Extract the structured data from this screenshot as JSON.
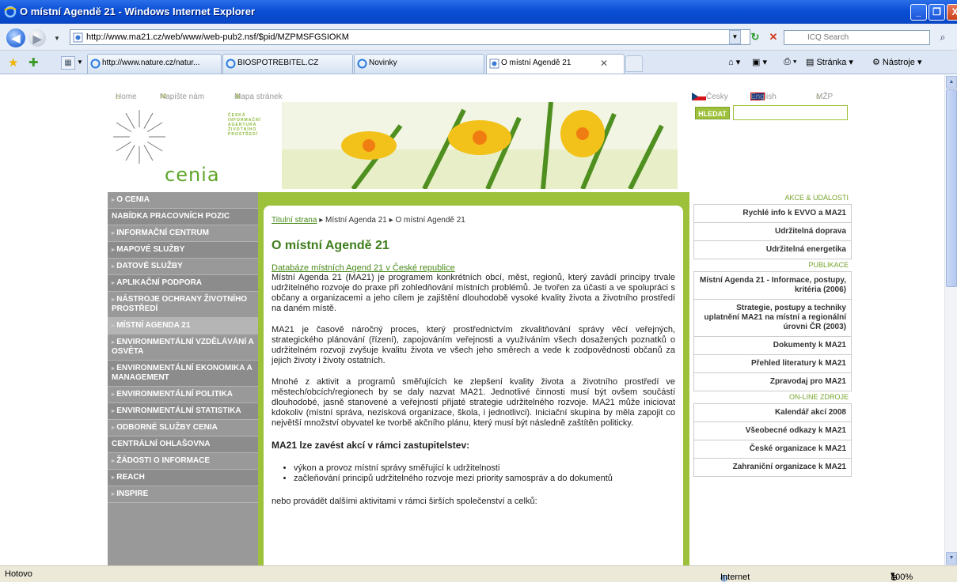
{
  "window": {
    "title": "O místní Agendě 21 - Windows Internet Explorer",
    "btn_min": "_",
    "btn_max": "❐",
    "btn_close": "X"
  },
  "address": {
    "url": "http://www.ma21.cz/web/www/web-pub2.nsf/$pid/MZPMSFGSIOKM"
  },
  "search": {
    "placeholder": "ICQ Search"
  },
  "tabs": [
    {
      "label": "http://www.nature.cz/natur..."
    },
    {
      "label": "BIOSPOTREBITEL.CZ"
    },
    {
      "label": "Novinky"
    },
    {
      "label": "O místní Agendě 21"
    }
  ],
  "commands": {
    "page": "Stránka",
    "tools": "Nástroje"
  },
  "site": {
    "topnav": {
      "home": "Home",
      "write": "Napište nám",
      "sitemap": "Mapa stránek",
      "czech": "Česky",
      "english": "English",
      "mzp": "MŽP"
    },
    "logo": {
      "word": "cenia",
      "agency": "ČESKÁ INFORMAČNÍ AGENTURA ŽIVOTNÍHO PROSTŘEDÍ"
    },
    "search_button": "HLEDAT",
    "leftnav": [
      {
        "label": "O CENIA",
        "bullet": true
      },
      {
        "label": "NABÍDKA PRACOVNÍCH POZIC",
        "bullet": false
      },
      {
        "label": "INFORMAČNÍ CENTRUM",
        "bullet": true
      },
      {
        "label": "MAPOVÉ SLUŽBY",
        "bullet": true
      },
      {
        "label": "DATOVÉ SLUŽBY",
        "bullet": true
      },
      {
        "label": "APLIKAČNÍ PODPORA",
        "bullet": true
      },
      {
        "label": "NÁSTROJE OCHRANY ŽIVOTNÍHO PROSTŘEDÍ",
        "bullet": true
      },
      {
        "label": "MÍSTNÍ AGENDA 21",
        "bullet": true
      },
      {
        "label": "ENVIRONMENTÁLNÍ VZDĚLÁVÁNÍ A OSVĚTA",
        "bullet": true
      },
      {
        "label": "ENVIRONMENTÁLNÍ EKONOMIKA A MANAGEMENT",
        "bullet": true
      },
      {
        "label": "ENVIRONMENTÁLNÍ POLITIKA",
        "bullet": true
      },
      {
        "label": "ENVIRONMENTÁLNÍ STATISTIKA",
        "bullet": true
      },
      {
        "label": "ODBORNÉ SLUŽBY CENIA",
        "bullet": true
      },
      {
        "label": "CENTRÁLNÍ OHLAŠOVNA",
        "bullet": false
      },
      {
        "label": "ŽÁDOSTI O INFORMACE",
        "bullet": true
      },
      {
        "label": "REACH",
        "bullet": true
      },
      {
        "label": "INSPIRE",
        "bullet": true
      }
    ],
    "breadcrumb": {
      "home": "Titulní strana",
      "level1": "Místní Agenda 21",
      "current": "O místní Agendě 21",
      "sep": "▸"
    },
    "title": "O místní Agendě 21",
    "db_link": "Databáze místních Agend 21 v České republice",
    "paragraphs": [
      "Místní Agenda 21 (MA21) je programem konkrétních obcí, měst, regionů, který zavádí principy trvale udržitelného rozvoje do praxe při zohledňování místních problémů. Je tvořen za účasti a ve spolupráci s občany a organizacemi a jeho cílem je zajištění dlouhodobě vysoké kvality života a životního prostředí na daném místě.",
      "MA21 je časově náročný proces, který prostřednictvím zkvalitňování správy věcí veřejných, strategického plánování (řízení), zapojováním veřejnosti a využíváním všech dosažených poznatků o udržitelném rozvoji zvyšuje kvalitu života ve všech jeho směrech a vede k zodpovědnosti občanů za jejich životy i životy ostatních.",
      "Mnohé z aktivit a programů směřujících ke zlepšení kvality života a životního prostředí ve městech/obcích/regionech by se daly nazvat MA21. Jednotlivé činnosti musí být ovšem součástí dlouhodobé, jasně stanovené a veřejností přijaté strategie udržitelného rozvoje. MA21 může iniciovat kdokoliv (místní správa, nezisková organizace, škola, i jednotlivci). Iniciační skupina by měla zapojit co největší množství obyvatel ke tvorbě akčního plánu, který musí být následně zaštítěn politicky."
    ],
    "subheading": "MA21 lze zavést akcí v rámci zastupitelstev:",
    "bullets": [
      "výkon a provoz místní správy směřující k udržitelnosti",
      "začleňování principů udržitelného rozvoje mezi priority samospráv a do dokumentů"
    ],
    "tail": "nebo provádět dalšími aktivitami v rámci širších společenství a celků:",
    "right": [
      {
        "heading": "AKCE & UDÁLOSTI",
        "links": [
          "Rychlé info k EVVO a MA21",
          "Udržitelná doprava",
          "Udržitelná energetika"
        ]
      },
      {
        "heading": "PUBLIKACE",
        "links": [
          "Místní Agenda 21 - Informace, postupy, kritéria (2006)",
          "Strategie, postupy a techniky uplatnění MA21 na místní a regionální úrovni ČR (2003)",
          "Dokumenty k MA21",
          "Přehled literatury k MA21",
          "Zpravodaj pro MA21"
        ]
      },
      {
        "heading": "ON-LINE ZDROJE",
        "links": [
          "Kalendář akcí 2008",
          "Všeobecné odkazy k MA21",
          "České organizace k MA21",
          "Zahraniční organizace k MA21"
        ]
      }
    ]
  },
  "status": {
    "text": "Hotovo",
    "zone": "Internet",
    "zoom": "100%"
  },
  "colors": {
    "accent": "#9ec13b",
    "nav_gray": "#999999",
    "title_bar": "#0b4fd6"
  }
}
